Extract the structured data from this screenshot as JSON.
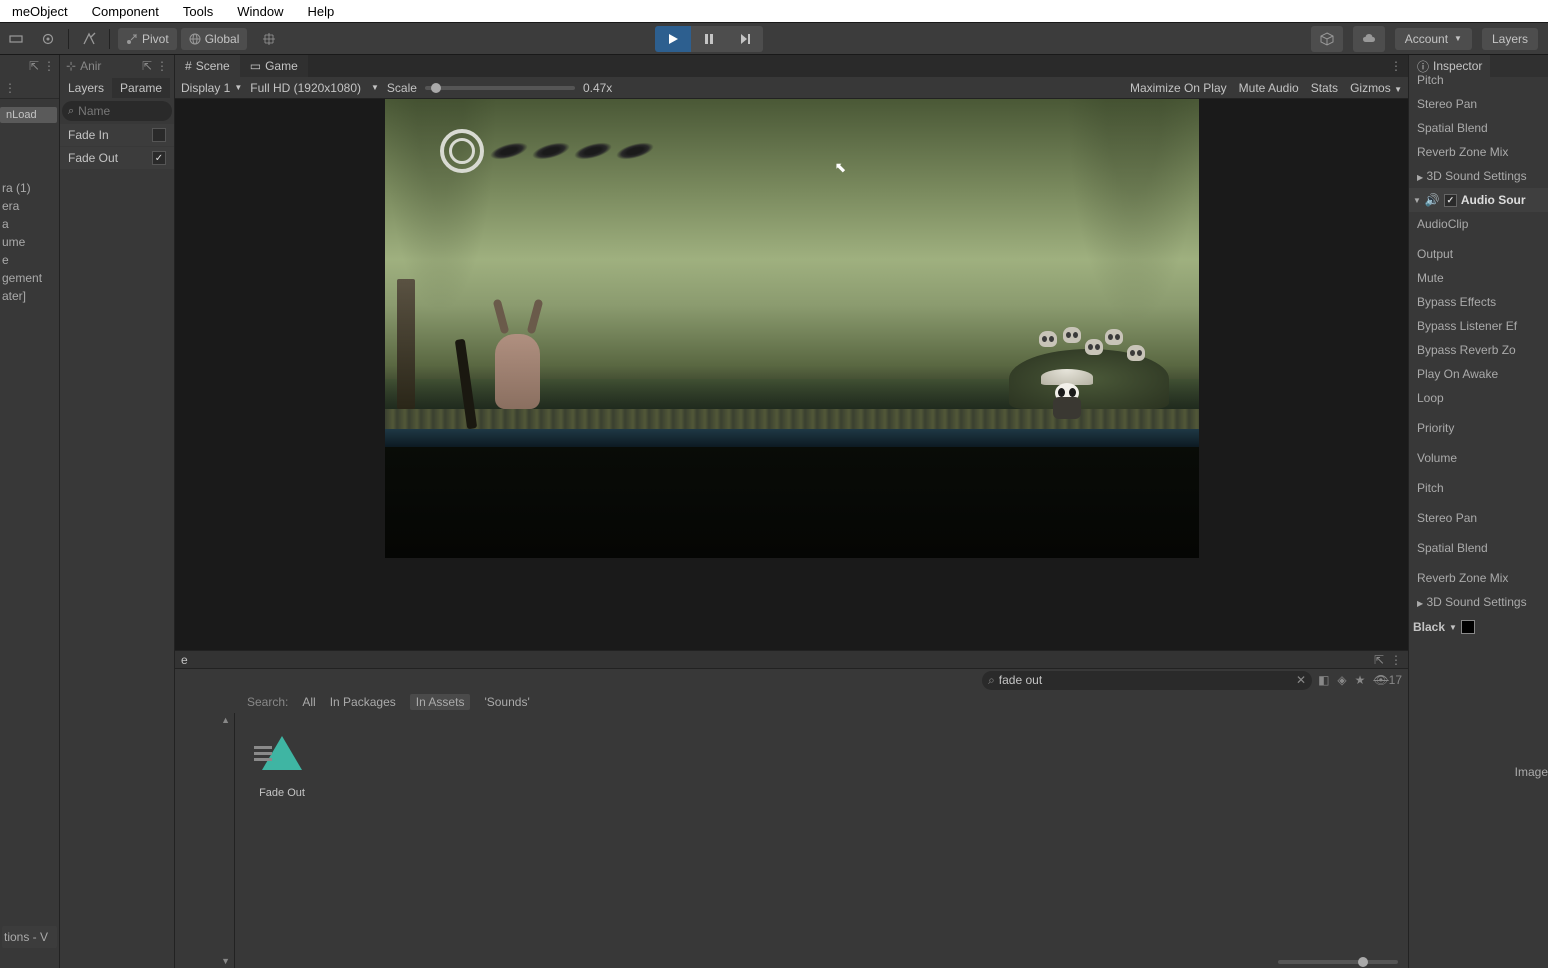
{
  "menubar": {
    "items": [
      "meObject",
      "Component",
      "Tools",
      "Window",
      "Help"
    ]
  },
  "toolbar": {
    "pivot": "Pivot",
    "global": "Global",
    "account": "Account",
    "layers": "Layers"
  },
  "left_panel": {
    "onload": "nLoad",
    "items": [
      "ra (1)",
      "era",
      "a",
      "ume",
      "e",
      "gement",
      "ater]"
    ],
    "bottom": "tions - V"
  },
  "anim_panel": {
    "tab": "Anir",
    "tabs": {
      "layers": "Layers",
      "params": "Parame"
    },
    "search_placeholder": "Name",
    "params": [
      {
        "name": "Fade In",
        "checked": false
      },
      {
        "name": "Fade Out",
        "checked": true
      }
    ]
  },
  "center": {
    "tabs": {
      "scene": "Scene",
      "game": "Game"
    },
    "display": "Display 1",
    "resolution": "Full HD (1920x1080)",
    "scale_label": "Scale",
    "scale_value": "0.47x",
    "maximize": "Maximize On Play",
    "mute": "Mute Audio",
    "stats": "Stats",
    "gizmos": "Gizmos"
  },
  "console": {
    "label": "e"
  },
  "project": {
    "search_label": "Search:",
    "search_value": "fade out",
    "filters": {
      "all": "All",
      "in_packages": "In Packages",
      "in_assets": "In Assets",
      "sounds": "'Sounds'"
    },
    "hidden_count": "17",
    "items": [
      {
        "name": "Fade Out"
      }
    ]
  },
  "inspector": {
    "tab": "Inspector",
    "props_top": [
      "Pitch",
      "Stereo Pan",
      "Spatial Blend",
      "Reverb Zone Mix"
    ],
    "sound_3d": "3D Sound Settings",
    "audio_source": "Audio Sour",
    "props_mid": [
      "AudioClip",
      "Output",
      "Mute",
      "Bypass Effects",
      "Bypass Listener Ef",
      "Bypass Reverb Zo",
      "Play On Awake",
      "Loop"
    ],
    "props_bot": [
      "Priority",
      "Volume",
      "Pitch",
      "Stereo Pan",
      "Spatial Blend",
      "Reverb Zone Mix"
    ],
    "sound_3d_2": "3D Sound Settings",
    "black": "Black",
    "image": "Image"
  }
}
